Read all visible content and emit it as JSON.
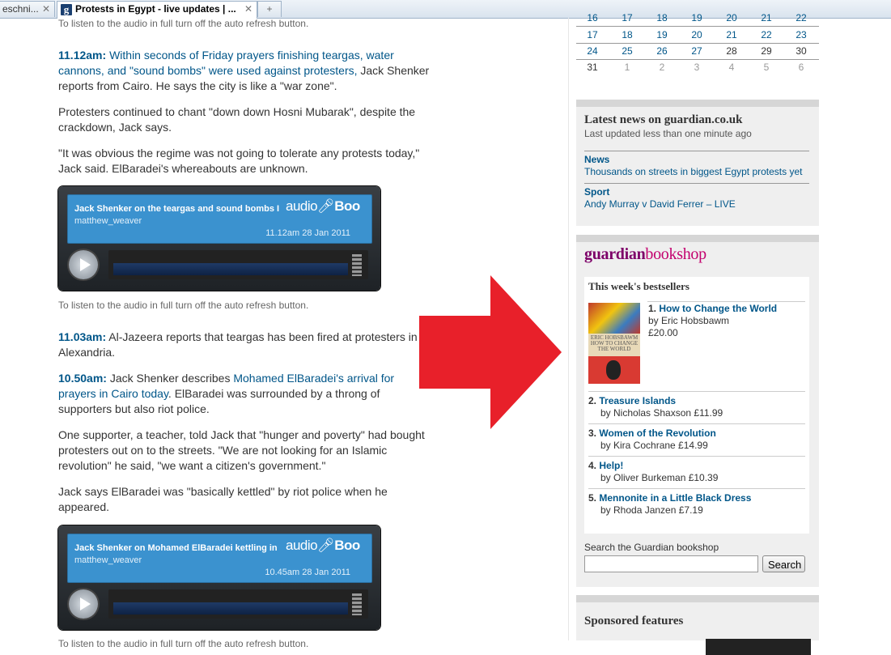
{
  "tabs": [
    {
      "label": "eschni...",
      "close": "✕"
    },
    {
      "label": "Protests in Egypt - live updates | ...",
      "close": "✕"
    }
  ],
  "newtab_symbol": "+",
  "main": {
    "note_top": "To listen to the audio in full turn off the auto refresh button.",
    "entry1": {
      "ts": "11.12am:",
      "link": "Within seconds of Friday prayers finishing teargas, water cannons, and \"sound bombs\" were used against protesters,",
      "rest": " Jack Shenker reports from Cairo. He says the city is like a \"war zone\"."
    },
    "p2": "Protesters continued to chant \"down down Hosni Mubarak\", despite the crackdown, Jack says.",
    "p3": "\"It was obvious the regime was not going to tolerate any protests today,\" Jack said. ElBaradei's whereabouts are unknown.",
    "player1": {
      "title": "Jack Shenker on the teargas and sound bombs I",
      "user": "matthew_weaver",
      "logo_a": "audio",
      "logo_b": "Boo",
      "date": "11.12am 28 Jan 2011"
    },
    "note_mid": "To listen to the audio in full turn off the auto refresh button.",
    "entry2": {
      "ts": "11.03am:",
      "rest": " Al-Jazeera reports that teargas has been fired at protesters in Alexandria."
    },
    "entry3": {
      "ts": "10.50am:",
      "pre": " Jack Shenker describes ",
      "link": "Mohamed ElBaradei's arrival for prayers in Cairo today",
      "rest": ". ElBaradei was surrounded by a throng of supporters but also riot police."
    },
    "p5": "One supporter, a teacher, told Jack that \"hunger and poverty\" had bought protesters out on to the streets. \"We are not looking for an Islamic revolution\" he said, \"we want a citizen's government.\"",
    "p6": "Jack says ElBaradei was \"basically kettled\" by riot police when he appeared.",
    "player2": {
      "title": "Jack Shenker on Mohamed ElBaradei kettling in",
      "user": "matthew_weaver",
      "logo_a": "audio",
      "logo_b": "Boo",
      "date": "10.45am 28 Jan 2011"
    },
    "note_bottom": "To listen to the audio in full turn off the auto refresh button."
  },
  "calendar": {
    "rows": [
      [
        "16",
        "17",
        "18",
        "19",
        "20",
        "21",
        "22"
      ],
      [
        "17",
        "18",
        "19",
        "20",
        "21",
        "22",
        "23"
      ],
      [
        "24",
        "25",
        "26",
        "27",
        "28",
        "29",
        "30"
      ],
      [
        "31",
        "1",
        "2",
        "3",
        "4",
        "5",
        "6"
      ]
    ]
  },
  "latest_news": {
    "title": "Latest news on guardian.co.uk",
    "updated": "Last updated less than one minute ago",
    "items": [
      {
        "section": "News",
        "headline": "Thousands on streets in biggest Egypt protests yet"
      },
      {
        "section": "Sport",
        "headline": "Andy Murray v David Ferrer – LIVE"
      }
    ]
  },
  "bookshop": {
    "brand_a": "guardian",
    "brand_b": "bookshop",
    "heading": "This week's bestsellers",
    "cover_text": "ERIC HOBSBAWM HOW TO CHANGE THE WORLD",
    "books": [
      {
        "num": "1.",
        "title": "How to Change the World",
        "by": "by Eric Hobsbawm",
        "price": "£20.00"
      },
      {
        "num": "2.",
        "title": "Treasure Islands",
        "by": "by Nicholas Shaxson £11.99"
      },
      {
        "num": "3.",
        "title": "Women of the Revolution",
        "by": "by Kira Cochrane £14.99"
      },
      {
        "num": "4.",
        "title": "Help!",
        "by": "by Oliver Burkeman £10.39"
      },
      {
        "num": "5.",
        "title": "Mennonite in a Little Black Dress",
        "by": "by Rhoda Janzen £7.19"
      }
    ],
    "search_label": "Search the Guardian bookshop",
    "search_value": "",
    "search_button": "Search"
  },
  "sponsored": {
    "title": "Sponsored features"
  },
  "colors": {
    "link": "#005689",
    "arrow": "#e8202a",
    "brand_guardian": "#7d0068",
    "brand_bookshop": "#c3006e"
  }
}
